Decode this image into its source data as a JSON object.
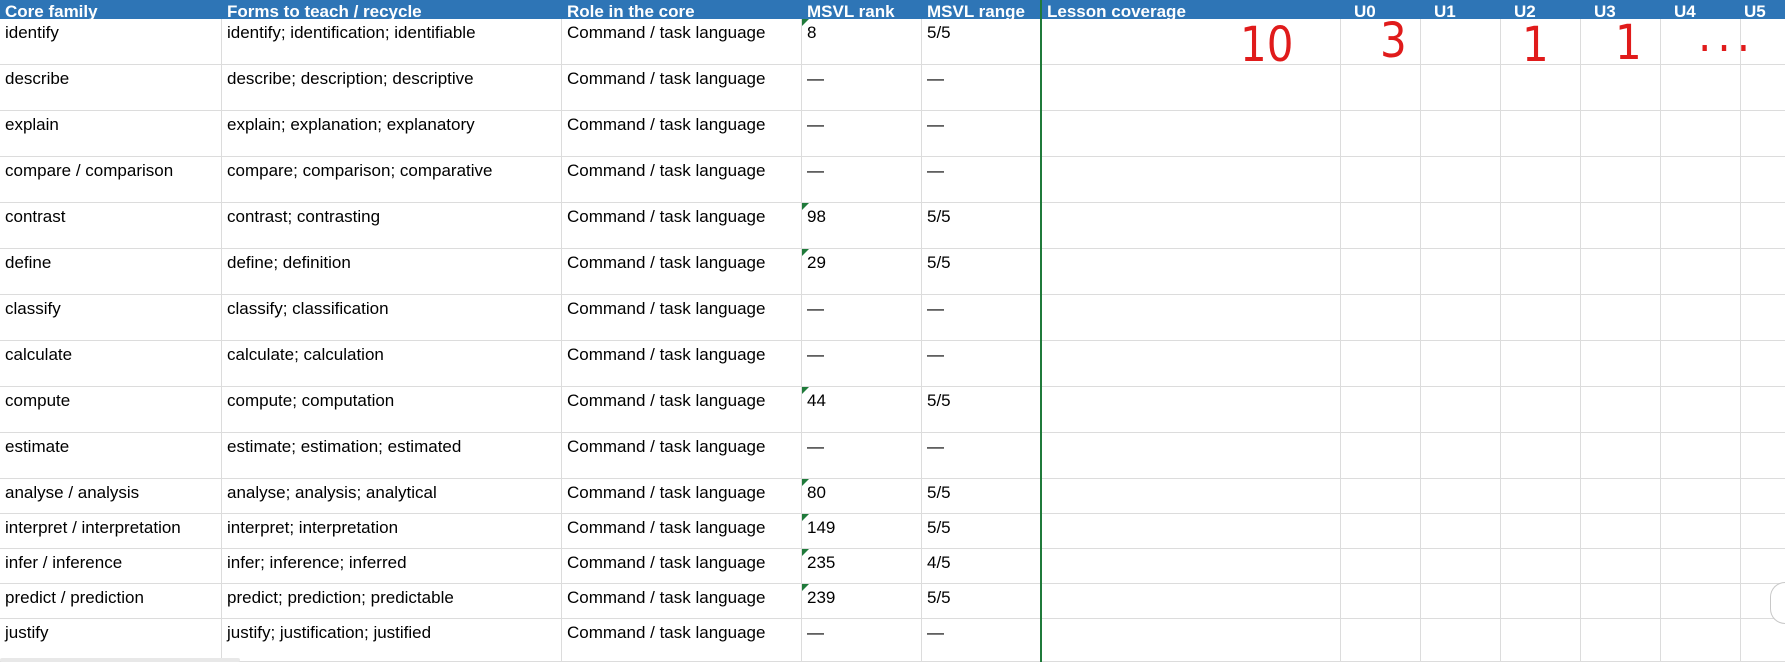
{
  "headers": {
    "core_family": "Core family",
    "forms": "Forms to teach / recycle",
    "role": "Role in the core",
    "rank": "MSVL rank",
    "range": "MSVL range",
    "lesson": "Lesson coverage",
    "u0": "U0",
    "u1": "U1",
    "u2": "U2",
    "u3": "U3",
    "u4": "U4",
    "u5": "U5"
  },
  "rows": [
    {
      "family": "identify",
      "forms": "identify; identification; identifiable",
      "role": "Command / task language",
      "rank": "8",
      "range": "5/5",
      "flag": true
    },
    {
      "family": "describe",
      "forms": "describe; description; descriptive",
      "role": "Command / task language",
      "rank": "—",
      "range": "—",
      "flag": false
    },
    {
      "family": "explain",
      "forms": "explain; explanation; explanatory",
      "role": "Command / task language",
      "rank": "—",
      "range": "—",
      "flag": false
    },
    {
      "family": "compare / comparison",
      "forms": "compare; comparison; comparative",
      "role": "Command / task language",
      "rank": "—",
      "range": "—",
      "flag": false
    },
    {
      "family": "contrast",
      "forms": "contrast; contrasting",
      "role": "Command / task language",
      "rank": "98",
      "range": "5/5",
      "flag": true
    },
    {
      "family": "define",
      "forms": "define; definition",
      "role": "Command / task language",
      "rank": "29",
      "range": "5/5",
      "flag": true
    },
    {
      "family": "classify",
      "forms": "classify; classification",
      "role": "Command / task language",
      "rank": "—",
      "range": "—",
      "flag": false
    },
    {
      "family": "calculate",
      "forms": "calculate; calculation",
      "role": "Command / task language",
      "rank": "—",
      "range": "—",
      "flag": false
    },
    {
      "family": "compute",
      "forms": "compute; computation",
      "role": "Command / task language",
      "rank": "44",
      "range": "5/5",
      "flag": true
    },
    {
      "family": "estimate",
      "forms": "estimate; estimation; estimated",
      "role": "Command / task language",
      "rank": "—",
      "range": "—",
      "flag": false
    },
    {
      "family": "analyse / analysis",
      "forms": "analyse; analysis; analytical",
      "role": "Command / task language",
      "rank": "80",
      "range": "5/5",
      "flag": true
    },
    {
      "family": "interpret / interpretation",
      "forms": "interpret; interpretation",
      "role": "Command / task language",
      "rank": "149",
      "range": "5/5",
      "flag": true
    },
    {
      "family": "infer / inference",
      "forms": "infer; inference; inferred",
      "role": "Command / task language",
      "rank": "235",
      "range": "4/5",
      "flag": true
    },
    {
      "family": "predict / prediction",
      "forms": "predict; prediction; predictable",
      "role": "Command / task language",
      "rank": "239",
      "range": "5/5",
      "flag": true
    },
    {
      "family": "justify",
      "forms": "justify; justification; justified",
      "role": "Command / task language",
      "rank": "—",
      "range": "—",
      "flag": false
    }
  ],
  "annotations": {
    "lesson": "10",
    "u0": "3",
    "u2": "1",
    "u3": "1",
    "u4": "..."
  },
  "colors": {
    "header_bg": "#2e75b6",
    "header_text": "#ffffff",
    "annotation": "#e01b1b",
    "flag": "#1f7a3a",
    "gridline": "#dcdcdc"
  }
}
